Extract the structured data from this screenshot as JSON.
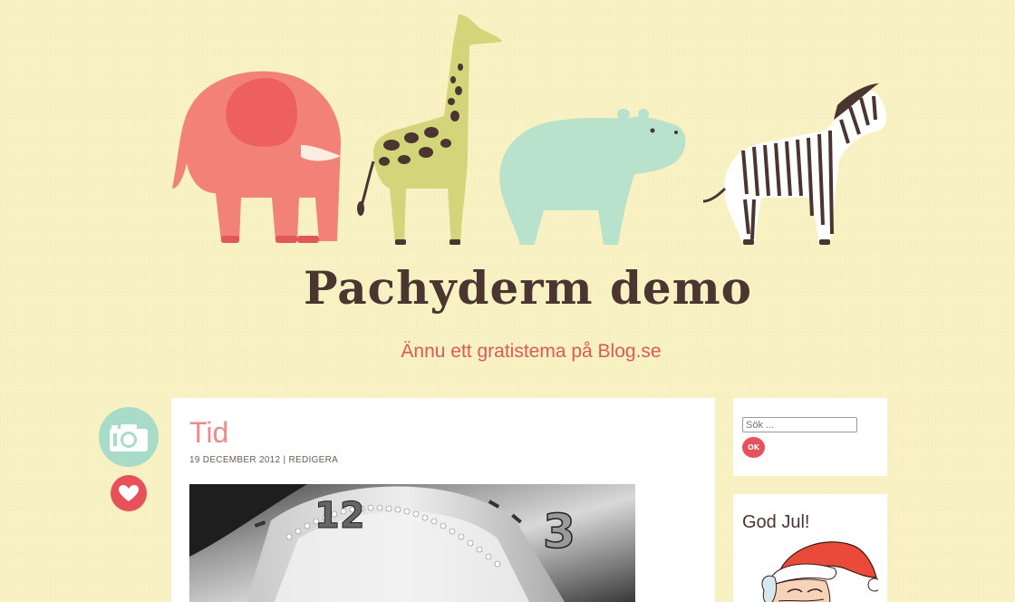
{
  "header": {
    "site_title": "Pachyderm demo",
    "tagline": "Ännu ett gratistema på Blog.se",
    "animals": [
      "elephant",
      "giraffe",
      "hippo",
      "zebra"
    ]
  },
  "post": {
    "title": "Tid",
    "date": "19 December 2012",
    "separator": "|",
    "edit_label": "Redigera",
    "icons": [
      "camera-icon",
      "heart-icon"
    ]
  },
  "sidebar": {
    "search": {
      "placeholder": "Sök ...",
      "button_label": "OK"
    },
    "widget_title": "God Jul!"
  },
  "colors": {
    "background": "#f9f3c4",
    "title": "#4a3530",
    "accent_red": "#e8505a",
    "accent_mint": "#a8dcc8",
    "post_title": "#f08a8a"
  }
}
